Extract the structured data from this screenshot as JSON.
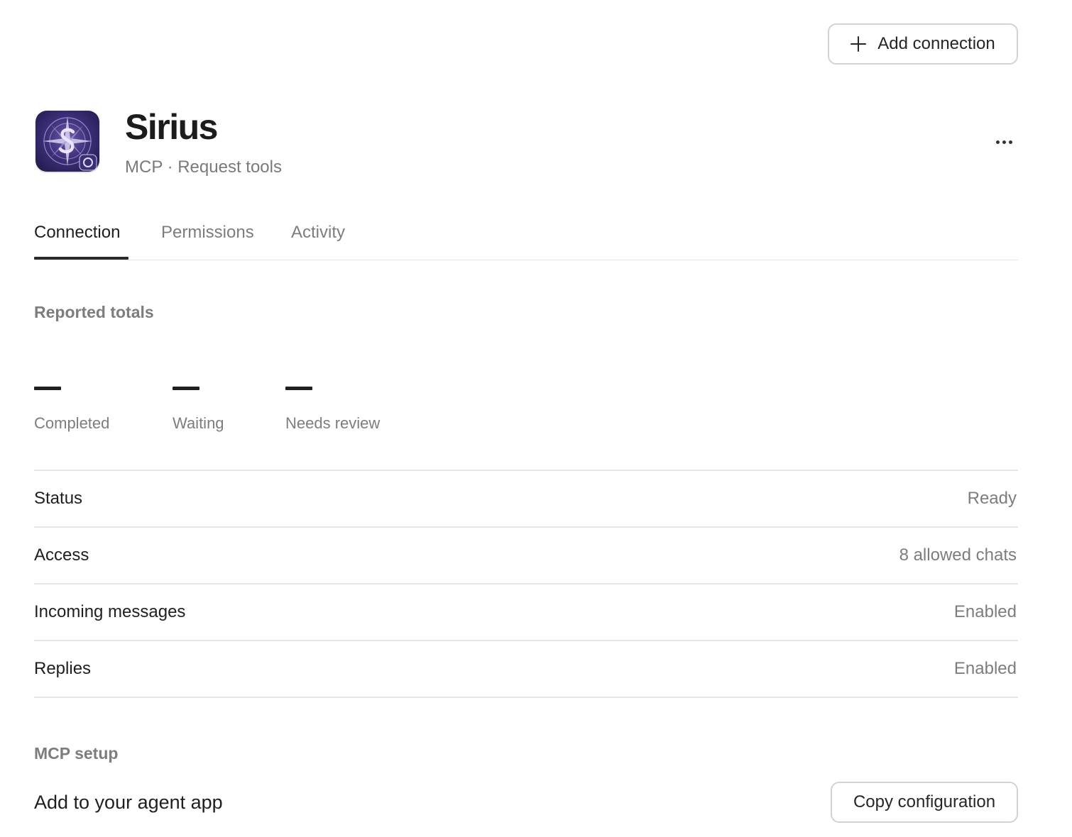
{
  "header": {
    "add_connection_label": "Add connection",
    "more_icon": "more-horizontal-icon"
  },
  "app": {
    "name": "Sirius",
    "subtitle": "MCP · Request tools",
    "icon": "sirius-compass-logo"
  },
  "tabs": [
    {
      "label": "Connection",
      "active": true
    },
    {
      "label": "Permissions",
      "active": false
    },
    {
      "label": "Activity",
      "active": false
    }
  ],
  "reported_totals": {
    "heading": "Reported totals",
    "stats": [
      {
        "value": "—",
        "label": "Completed"
      },
      {
        "value": "—",
        "label": "Waiting"
      },
      {
        "value": "—",
        "label": "Needs review"
      }
    ]
  },
  "details": [
    {
      "label": "Status",
      "value": "Ready"
    },
    {
      "label": "Access",
      "value": "8 allowed chats"
    },
    {
      "label": "Incoming messages",
      "value": "Enabled"
    },
    {
      "label": "Replies",
      "value": "Enabled"
    }
  ],
  "mcp_setup": {
    "heading": "MCP setup",
    "label": "Add to your agent app",
    "copy_button_label": "Copy configuration"
  },
  "colors": {
    "primary_text": "#1f1f1f",
    "secondary_text": "#7d7d7d",
    "border": "#e6e6e6",
    "icon_purple": "#3d2f7a"
  }
}
